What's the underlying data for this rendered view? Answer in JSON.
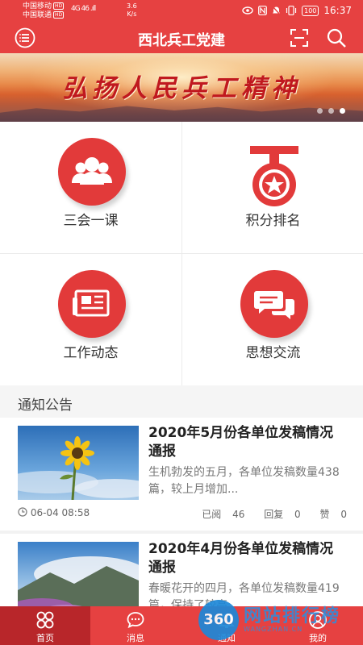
{
  "status_bar": {
    "carrier1": "中国移动",
    "carrier2": "中国联通",
    "hd": "HD",
    "signal": "4G 46 .ıll",
    "speed_value": "3.6",
    "speed_unit": "K/s",
    "battery": "100",
    "time": "16:37"
  },
  "app_bar": {
    "title": "西北兵工党建"
  },
  "banner": {
    "text": "弘扬人民兵工精神",
    "slide_count": 3,
    "active_slide": 3
  },
  "grid": {
    "items": [
      {
        "label": "三会一课",
        "icon": "people-group-icon"
      },
      {
        "label": "积分排名",
        "icon": "medal-icon"
      },
      {
        "label": "工作动态",
        "icon": "newspaper-icon"
      },
      {
        "label": "思想交流",
        "icon": "chat-bubbles-icon"
      }
    ]
  },
  "notices": {
    "section_title": "通知公告",
    "items": [
      {
        "title": "2020年5月份各单位发稿情况通报",
        "summary": "生机勃发的五月，各单位发稿数量438篇，较上月增加...",
        "date": "06-04 08:58",
        "views_label": "已阅",
        "views": "46",
        "replies_label": "回复",
        "replies": "0",
        "likes_label": "赞",
        "likes": "0"
      },
      {
        "title": "2020年4月份各单位发稿情况通报",
        "summary": "春暖花开的四月，各单位发稿数量419篇，保持了较高..."
      }
    ]
  },
  "tab_bar": {
    "tabs": [
      {
        "label": "首页",
        "active": true
      },
      {
        "label": "消息",
        "active": false
      },
      {
        "label": "通知",
        "active": false
      },
      {
        "label": "我的",
        "active": false
      }
    ]
  },
  "watermark": {
    "badge": "360",
    "text": "网站排行榜",
    "sub": "WANGZHAN.CN"
  },
  "colors": {
    "primary": "#e64141",
    "tab_active": "#b8262a",
    "icon_circle": "#e23a3a"
  }
}
